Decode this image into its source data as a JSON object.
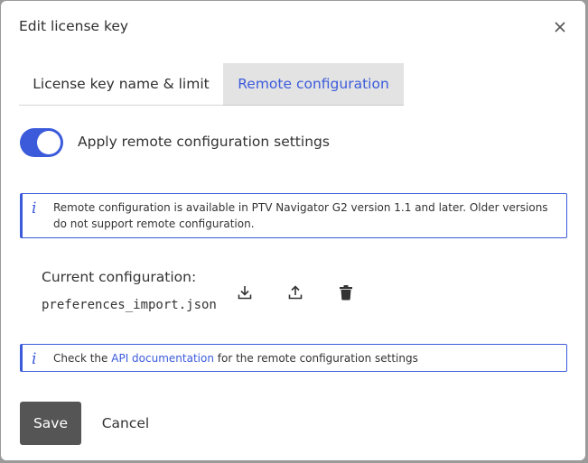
{
  "dialog": {
    "title": "Edit license key",
    "close_icon": "close-icon"
  },
  "tabs": [
    {
      "label": "License key name & limit",
      "active": false
    },
    {
      "label": "Remote configuration",
      "active": true
    }
  ],
  "toggle": {
    "label": "Apply remote configuration settings",
    "on": true
  },
  "info_version": {
    "icon": "info-icon",
    "text": "Remote configuration is available in PTV Navigator G2 version 1.1 and later. Older versions do not support remote configuration."
  },
  "config": {
    "label": "Current configuration:",
    "filename": "preferences_import.json",
    "actions": [
      "download-icon",
      "upload-icon",
      "trash-icon"
    ]
  },
  "info_api": {
    "icon": "info-icon",
    "prefix": "Check the",
    "link": "API documentation",
    "suffix": "for the remote configuration settings"
  },
  "footer": {
    "save_label": "Save",
    "cancel_label": "Cancel"
  },
  "colors": {
    "accent": "#3b5bdb",
    "save_bg": "#555555",
    "active_tab_bg": "#e3e3e3"
  }
}
